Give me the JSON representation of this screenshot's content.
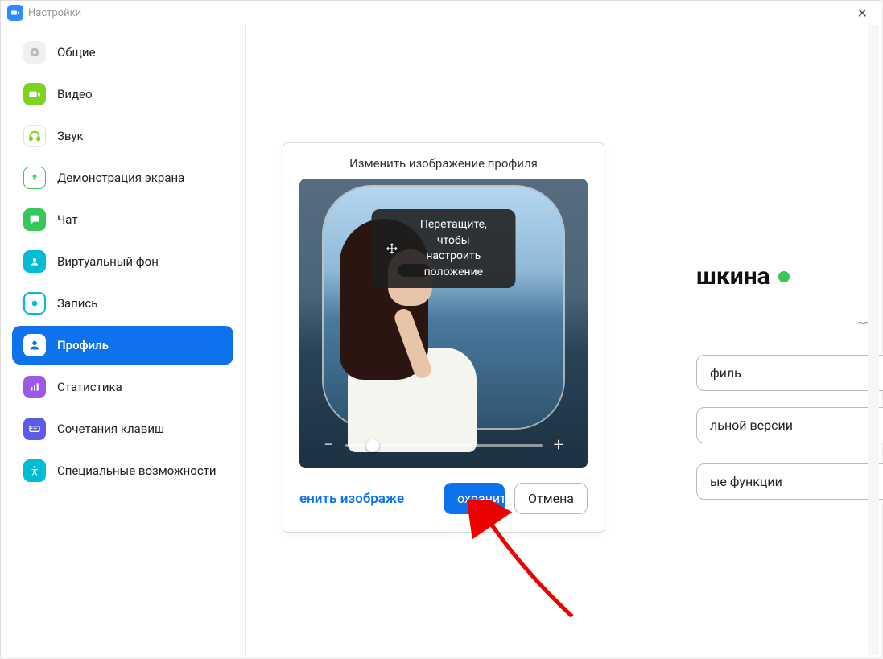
{
  "window": {
    "title": "Настройки"
  },
  "sidebar": {
    "items": [
      {
        "label": "Общие"
      },
      {
        "label": "Видео"
      },
      {
        "label": "Звук"
      },
      {
        "label": "Демонстрация экрана"
      },
      {
        "label": "Чат"
      },
      {
        "label": "Виртуальный фон"
      },
      {
        "label": "Запись"
      },
      {
        "label": "Профиль"
      },
      {
        "label": "Статистика"
      },
      {
        "label": "Сочетания клавиш"
      },
      {
        "label": "Специальные возможности"
      }
    ],
    "active_index": 7
  },
  "profile": {
    "name_visible_fragment": "шкина",
    "button1_fragment": "филь",
    "button2_fragment": "льной версии",
    "button3_fragment": "ые функции"
  },
  "modal": {
    "title": "Изменить изображение профиля",
    "drag_tip_line1": "Перетащите, чтобы",
    "drag_tip_line2": "настроить положение",
    "change_image": "енить изображе",
    "save": "охранит",
    "cancel": "Отмена",
    "zoom_minus": "−",
    "zoom_plus": "+"
  }
}
